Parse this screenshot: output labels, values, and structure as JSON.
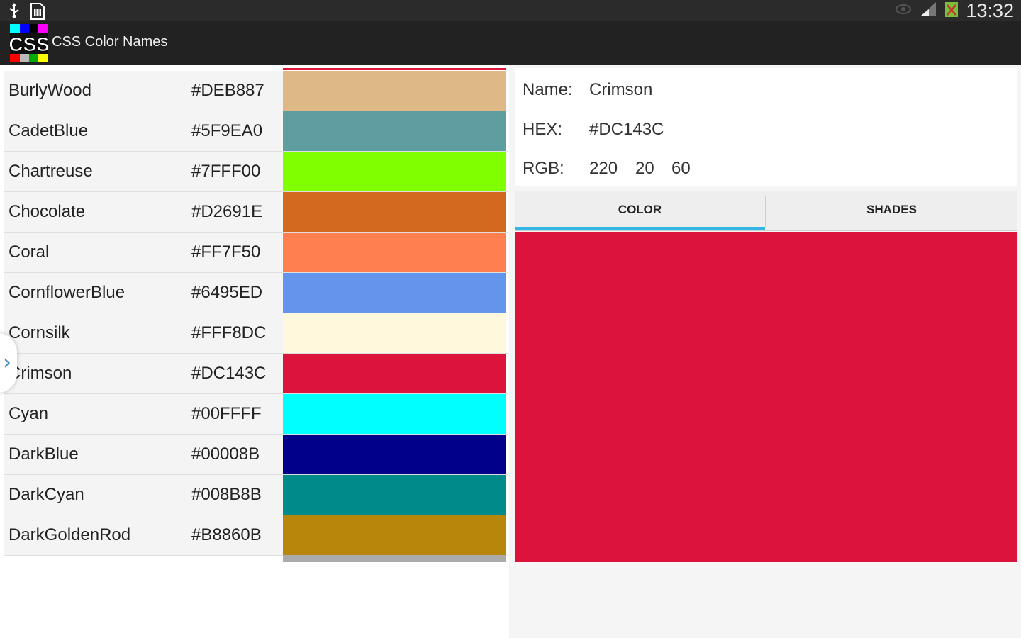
{
  "status_bar": {
    "time": "13:32",
    "left_icons": [
      "usb-icon",
      "sim-document-icon"
    ],
    "right_icons": [
      "eye-icon",
      "signal-icon",
      "battery-icon"
    ]
  },
  "app": {
    "title": "CSS Color Names",
    "logo_text": "CSS"
  },
  "colors": [
    {
      "name": "BurlyWood",
      "hex": "#DEB887"
    },
    {
      "name": "CadetBlue",
      "hex": "#5F9EA0"
    },
    {
      "name": "Chartreuse",
      "hex": "#7FFF00"
    },
    {
      "name": "Chocolate",
      "hex": "#D2691E"
    },
    {
      "name": "Coral",
      "hex": "#FF7F50"
    },
    {
      "name": "CornflowerBlue",
      "hex": "#6495ED"
    },
    {
      "name": "Cornsilk",
      "hex": "#FFF8DC"
    },
    {
      "name": "Crimson",
      "hex": "#DC143C"
    },
    {
      "name": "Cyan",
      "hex": "#00FFFF"
    },
    {
      "name": "DarkBlue",
      "hex": "#00008B"
    },
    {
      "name": "DarkCyan",
      "hex": "#008B8B"
    },
    {
      "name": "DarkGoldenRod",
      "hex": "#B8860B"
    }
  ],
  "detail": {
    "name_label": "Name:",
    "name_value": "Crimson",
    "hex_label": "HEX:",
    "hex_value": "#DC143C",
    "rgb_label": "RGB:",
    "rgb_r": "220",
    "rgb_g": "20",
    "rgb_b": "60"
  },
  "tabs": {
    "color_label": "COLOR",
    "shades_label": "SHADES",
    "active": "COLOR"
  },
  "accent_color": "#33B5E5"
}
